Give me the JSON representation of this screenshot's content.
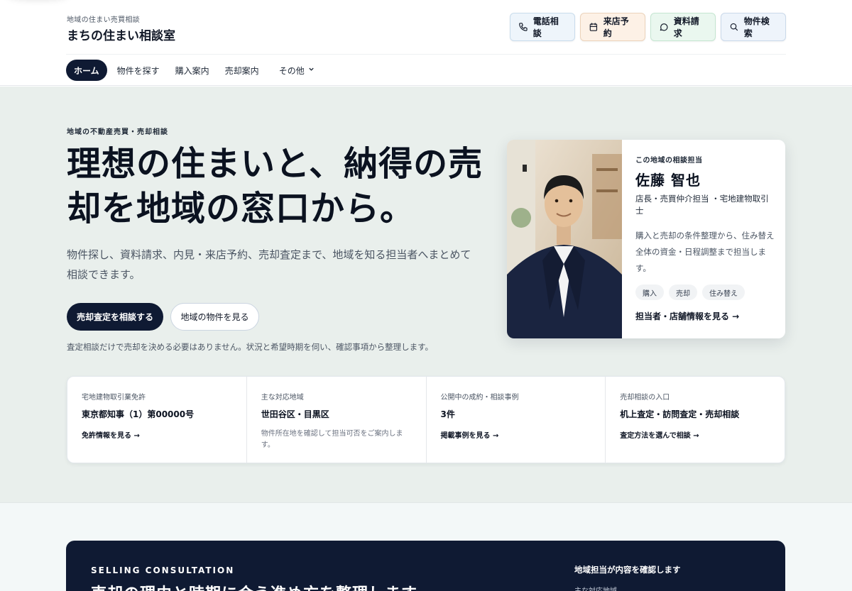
{
  "header": {
    "brand_sub": "地域の住まい売買相談",
    "brand_title": "まちの住まい相談室",
    "actions": [
      {
        "label": "電話相談",
        "icon": "phone-icon"
      },
      {
        "label": "来店予約",
        "icon": "calendar-icon"
      },
      {
        "label": "資料請求",
        "icon": "chat-icon"
      },
      {
        "label": "物件検索",
        "icon": "search-icon"
      }
    ],
    "nav": [
      {
        "label": "ホーム",
        "active": true
      },
      {
        "label": "物件を探す"
      },
      {
        "label": "購入案内"
      },
      {
        "label": "売却案内"
      },
      {
        "label": "その他",
        "icon": "chevron-down-icon"
      }
    ]
  },
  "hero": {
    "eyebrow": "地域の不動産売買・売却相談",
    "title": "理想の住まいと、納得の売却を地域の窓口から。",
    "lead": "物件探し、資料請求、内見・来店予約、売却査定まで、地域を知る担当者へまとめて相談できます。",
    "primary_cta": "売却査定を相談する",
    "secondary_cta": "地域の物件を見る",
    "note": "査定相談だけで売却を決める必要はありません。状況と希望時期を伺い、確認事項から整理します。"
  },
  "agent": {
    "label": "この地域の相談担当",
    "name": "佐藤 智也",
    "role": "店長・売買仲介担当 ・宅地建物取引士",
    "description": "購入と売却の条件整理から、住み替え全体の資金・日程調整まで担当します。",
    "tags": [
      "購入",
      "売却",
      "住み替え"
    ],
    "link": "担当者・店舗情報を見る →"
  },
  "info": [
    {
      "label": "宅地建物取引業免許",
      "value": "東京都知事（1）第00000号",
      "link": "免許情報を見る →"
    },
    {
      "label": "主な対応地域",
      "value": "世田谷区・目黒区",
      "note": "物件所在地を確認して担当可否をご案内します。"
    },
    {
      "label": "公開中の成約・相談事例",
      "value": "3件",
      "link": "掲載事例を見る →"
    },
    {
      "label": "売却相談の入口",
      "value": "机上査定・訪問査定・売却相談",
      "link": "査定方法を選んで相談 →"
    }
  ],
  "consultation": {
    "eyebrow": "SELLING CONSULTATION",
    "title": "売却の理由と時期に合う進め方を整理します",
    "side_title": "地域担当が内容を確認します",
    "side_label": "主な対応地域"
  },
  "colors": {
    "navy": "#0f1a33",
    "hero_bg": "#e9efec"
  }
}
